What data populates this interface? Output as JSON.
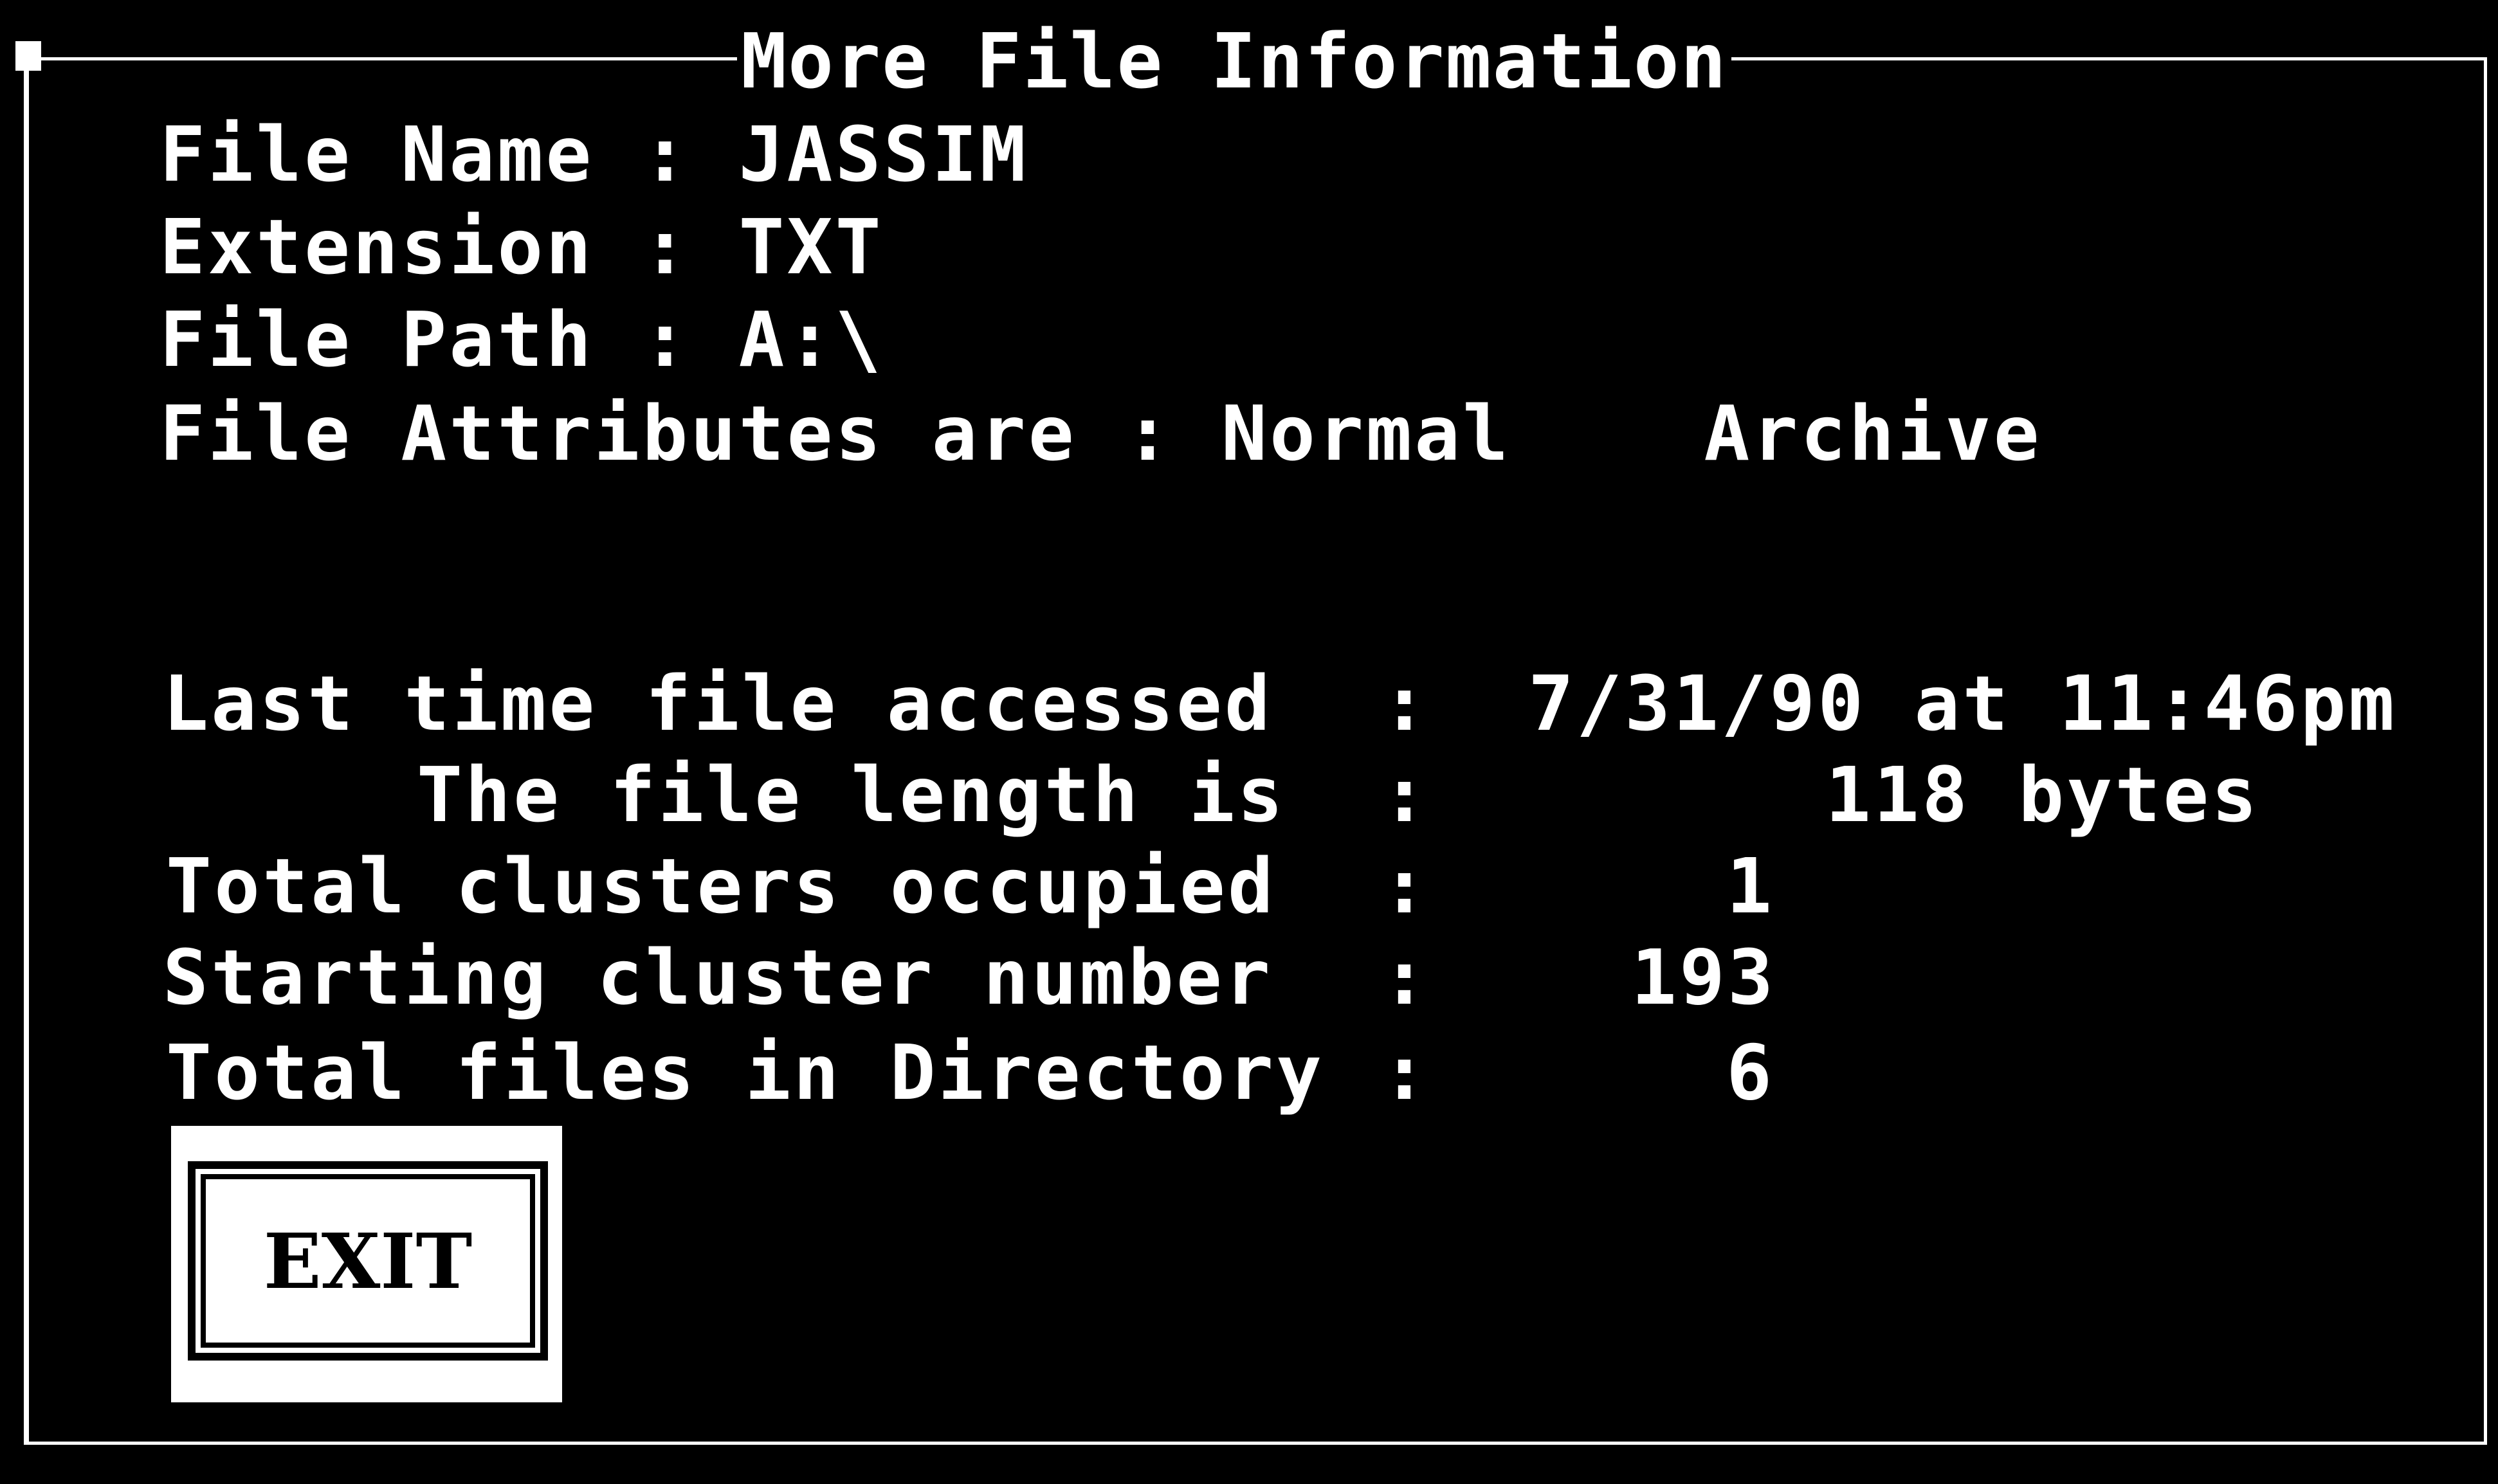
{
  "window": {
    "title": "More File Information"
  },
  "file": {
    "name_label": "File Name : JASSIM",
    "extension_label": "Extension : TXT",
    "path_label": "File Path : A:\\",
    "attributes_label": "File Attributes are : Normal    Archive"
  },
  "details": {
    "last_accessed_label": "Last time file accessed",
    "last_accessed_sep": ":",
    "last_accessed_value": "7/31/90 at 11:46pm",
    "length_label": "The file length is",
    "length_sep": ":",
    "length_value": "118 bytes",
    "clusters_label": "Total clusters occupied",
    "clusters_sep": ":",
    "clusters_value": "1",
    "start_cluster_label": "Starting cluster number",
    "start_cluster_sep": ":",
    "start_cluster_value": "193",
    "total_files_label": "Total files in Directory",
    "total_files_sep": ":",
    "total_files_value": "6"
  },
  "buttons": {
    "exit_label": "EXIT"
  }
}
